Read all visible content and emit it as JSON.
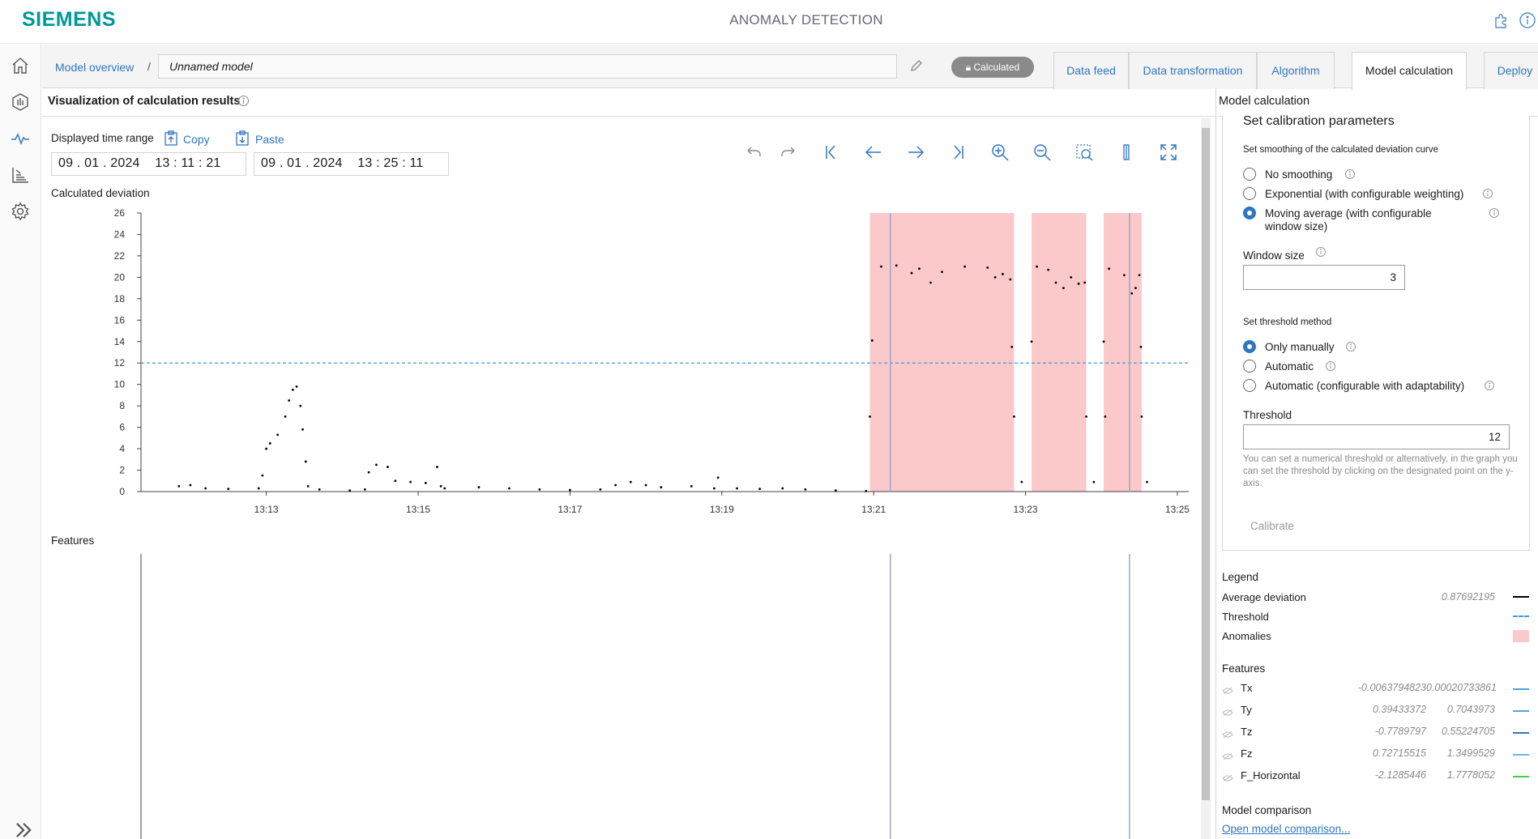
{
  "header": {
    "brand": "SIEMENS",
    "app_title": "ANOMALY DETECTION"
  },
  "nav": {
    "items": [
      "home-icon",
      "analysis-icon",
      "pulse-icon",
      "chart-bar-icon",
      "gear-icon",
      "expand-icon"
    ],
    "active": "pulse-icon"
  },
  "breadcrumb": {
    "overview": "Model overview",
    "separator": "/",
    "model_name": "Unnamed model"
  },
  "status_badge": "Calculated",
  "tabs": [
    {
      "label": "Data feed",
      "active": false
    },
    {
      "label": "Data transformation",
      "active": false
    },
    {
      "label": "Algorithm",
      "active": false
    },
    {
      "label": "Model calculation",
      "active": true
    },
    {
      "label": "Deploy",
      "active": false
    }
  ],
  "viz": {
    "title": "Visualization of calculation results",
    "time_range_label": "Displayed time range",
    "copy": "Copy",
    "paste": "Paste",
    "start": "09 . 01 . 2024    13 : 11 : 21",
    "end": "09 . 01 . 2024    13 : 25 : 11",
    "deviation_label": "Calculated deviation",
    "features_label": "Features"
  },
  "chart_data": {
    "type": "scatter",
    "title": "Calculated deviation",
    "xlabel": "",
    "ylabel": "",
    "x_ticks": [
      "13:13",
      "13:15",
      "13:17",
      "13:19",
      "13:21",
      "13:23",
      "13:25"
    ],
    "x_tick_minutes": [
      13,
      15,
      17,
      19,
      21,
      23,
      25
    ],
    "xlim_minutes": [
      11.35,
      25.15
    ],
    "y_ticks": [
      0,
      2,
      4,
      6,
      8,
      10,
      12,
      14,
      16,
      18,
      20,
      22,
      24,
      26
    ],
    "ylim": [
      0,
      26
    ],
    "threshold": 12,
    "anomaly_ranges_minutes": [
      [
        20.95,
        22.85
      ],
      [
        23.08,
        23.8
      ],
      [
        24.03,
        24.53
      ]
    ],
    "cursor_minutes": [
      21.22,
      24.37
    ],
    "series": [
      {
        "name": "Average deviation",
        "points": [
          [
            11.85,
            0.5
          ],
          [
            12.0,
            0.6
          ],
          [
            12.2,
            0.3
          ],
          [
            12.5,
            0.25
          ],
          [
            12.9,
            0.3
          ],
          [
            12.95,
            1.5
          ],
          [
            13.0,
            4.0
          ],
          [
            13.05,
            4.5
          ],
          [
            13.15,
            5.3
          ],
          [
            13.25,
            7.0
          ],
          [
            13.3,
            8.5
          ],
          [
            13.35,
            9.5
          ],
          [
            13.4,
            9.8
          ],
          [
            13.45,
            8.0
          ],
          [
            13.48,
            5.8
          ],
          [
            13.52,
            2.8
          ],
          [
            13.55,
            0.5
          ],
          [
            13.7,
            0.2
          ],
          [
            14.1,
            0.1
          ],
          [
            14.3,
            0.2
          ],
          [
            14.35,
            1.8
          ],
          [
            14.45,
            2.5
          ],
          [
            14.6,
            2.3
          ],
          [
            14.7,
            1.0
          ],
          [
            14.9,
            0.9
          ],
          [
            15.1,
            0.8
          ],
          [
            15.3,
            0.5
          ],
          [
            15.25,
            2.3
          ],
          [
            15.35,
            0.3
          ],
          [
            15.8,
            0.4
          ],
          [
            16.2,
            0.3
          ],
          [
            16.6,
            0.2
          ],
          [
            17.0,
            0.15
          ],
          [
            17.4,
            0.2
          ],
          [
            17.6,
            0.6
          ],
          [
            17.8,
            0.9
          ],
          [
            18.0,
            0.6
          ],
          [
            18.2,
            0.4
          ],
          [
            18.6,
            0.5
          ],
          [
            18.9,
            0.3
          ],
          [
            18.95,
            1.3
          ],
          [
            19.2,
            0.3
          ],
          [
            19.5,
            0.25
          ],
          [
            19.8,
            0.3
          ],
          [
            20.1,
            0.2
          ],
          [
            20.5,
            0.1
          ],
          [
            20.9,
            0.05
          ],
          [
            20.95,
            7.0
          ],
          [
            20.98,
            14.1
          ],
          [
            21.1,
            21.0
          ],
          [
            21.3,
            21.1
          ],
          [
            21.5,
            20.4
          ],
          [
            21.6,
            20.8
          ],
          [
            21.75,
            19.5
          ],
          [
            21.9,
            20.5
          ],
          [
            22.2,
            21.0
          ],
          [
            22.5,
            20.9
          ],
          [
            22.6,
            20.0
          ],
          [
            22.7,
            20.3
          ],
          [
            22.8,
            19.8
          ],
          [
            22.82,
            13.5
          ],
          [
            22.85,
            7.0
          ],
          [
            22.95,
            0.9
          ],
          [
            23.08,
            14.0
          ],
          [
            23.15,
            21.0
          ],
          [
            23.3,
            20.7
          ],
          [
            23.4,
            19.5
          ],
          [
            23.5,
            19.0
          ],
          [
            23.6,
            20.0
          ],
          [
            23.7,
            19.4
          ],
          [
            23.78,
            19.5
          ],
          [
            23.8,
            7.0
          ],
          [
            23.9,
            0.9
          ],
          [
            24.03,
            14.0
          ],
          [
            24.05,
            7.0
          ],
          [
            24.1,
            20.8
          ],
          [
            24.3,
            20.2
          ],
          [
            24.4,
            18.5
          ],
          [
            24.45,
            19.0
          ],
          [
            24.5,
            20.2
          ],
          [
            24.52,
            13.5
          ],
          [
            24.53,
            7.0
          ],
          [
            24.6,
            0.9
          ]
        ]
      }
    ]
  },
  "right_panel": {
    "title": "Model calculation",
    "section_title": "Set calibration parameters",
    "smoothing_label": "Set smoothing of the calculated deviation curve",
    "smoothing_options": [
      {
        "label": "No smoothing",
        "selected": false
      },
      {
        "label": "Exponential (with configurable weighting)",
        "selected": false
      },
      {
        "label": "Moving average (with configurable",
        "label2": "window size)",
        "selected": true
      }
    ],
    "window_size_label": "Window size",
    "window_size_value": "3",
    "threshold_method_label": "Set threshold method",
    "threshold_options": [
      {
        "label": "Only manually",
        "selected": true
      },
      {
        "label": "Automatic",
        "selected": false
      },
      {
        "label": "Automatic (configurable with adaptability)",
        "selected": false
      }
    ],
    "threshold_label": "Threshold",
    "threshold_value": "12",
    "hint": "You can set a numerical threshold or alternatively, in the graph you can set the threshold by clicking on the designated point on the y-axis.",
    "calibrate": "Calibrate"
  },
  "legend": {
    "title": "Legend",
    "items": [
      {
        "label": "Average deviation",
        "value": "0.87692195",
        "color": "#000000"
      },
      {
        "label": "Threshold",
        "value": "",
        "color": "#3a9be8"
      },
      {
        "label": "Anomalies",
        "value": "",
        "color": "#fbc9c9"
      }
    ]
  },
  "features": {
    "title": "Features",
    "items": [
      {
        "label": "Tx",
        "min": "-0.0063794823",
        "max": "0.00020733861",
        "color": "#4da3e6"
      },
      {
        "label": "Ty",
        "min": "0.39433372",
        "max": "0.7043973",
        "color": "#4da3e6"
      },
      {
        "label": "Tz",
        "min": "-0.7789797",
        "max": "0.55224705",
        "color": "#2f76c1"
      },
      {
        "label": "Fz",
        "min": "0.72715515",
        "max": "1.3499529",
        "color": "#6cb6ef"
      },
      {
        "label": "F_Horizontal",
        "min": "-2.1285446",
        "max": "1.7778052",
        "color": "#3fcf4a"
      }
    ]
  },
  "comparison": {
    "title": "Model comparison",
    "link": "Open model comparison..."
  }
}
